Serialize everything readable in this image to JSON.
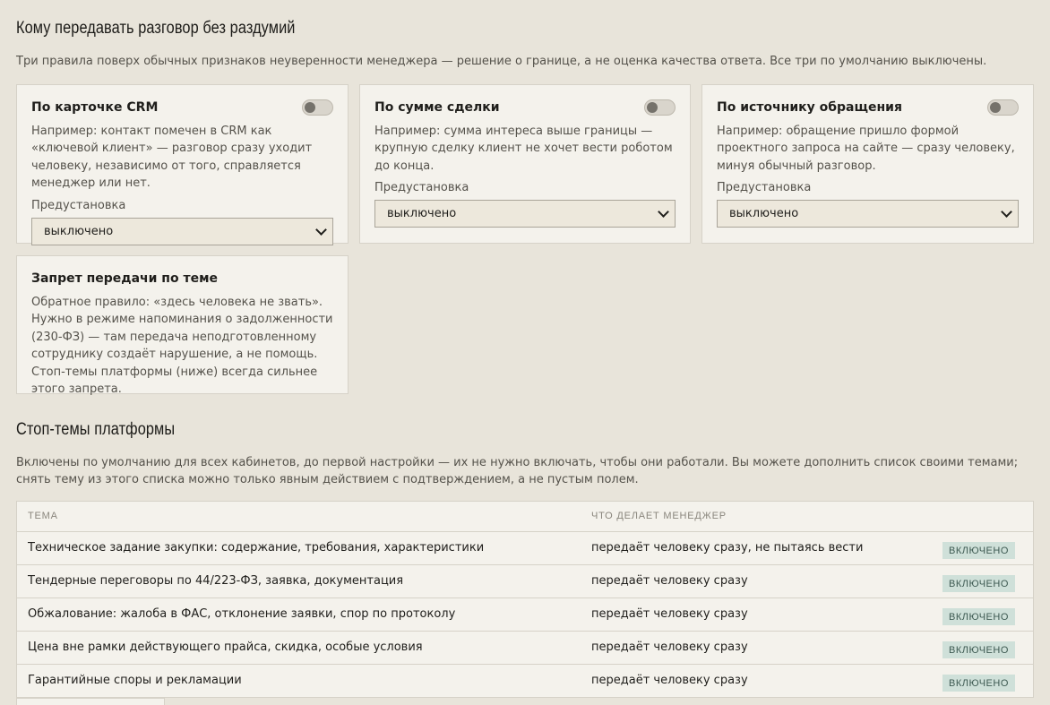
{
  "section1": {
    "title": "Кому передавать разговор без раздумий",
    "lede": "Три правила поверх обычных признаков неуверенности менеджера — решение о границе, а не оценка качества ответа. Все три по умолчанию выключены."
  },
  "cards": [
    {
      "title": "По карточке CRM",
      "toggle_on": false,
      "desc": "Например: контакт помечен в CRM как «ключевой клиент» — разговор сразу уходит человеку, независимо от того, справляется менеджер или нет.",
      "preset_label": "Предустановка",
      "preset_value": "выключено"
    },
    {
      "title": "По сумме сделки",
      "toggle_on": false,
      "desc": "Например: сумма интереса выше границы — крупную сделку клиент не хочет вести роботом до конца.",
      "preset_label": "Предустановка",
      "preset_value": "выключено"
    },
    {
      "title": "По источнику обращения",
      "toggle_on": false,
      "desc": "Например: обращение пришло формой проектного запроса на сайте — сразу человеку, минуя обычный разговор.",
      "preset_label": "Предустановка",
      "preset_value": "выключено"
    },
    {
      "title": "Запрет передачи по теме",
      "desc": "Обратное правило: «здесь человека не звать». Нужно в режиме напоминания о задолженности (230-ФЗ) — там передача неподготовленному сотруднику создаёт нарушение, а не помощь. Стоп-темы платформы (ниже) всегда сильнее этого запрета."
    }
  ],
  "section2": {
    "title": "Стоп-темы платформы",
    "lede": "Включены по умолчанию для всех кабинетов, до первой настройки — их не нужно включать, чтобы они работали. Вы можете дополнить список своими темами; снять тему из этого списка можно только явным действием с подтверждением, а не пустым полем."
  },
  "table": {
    "headers": [
      "Тема",
      "Что делает менеджер",
      ""
    ],
    "rows": [
      {
        "topic": "Техническое задание закупки: содержание, требования, характеристики",
        "action": "передаёт человеку сразу, не пытаясь вести",
        "status": "включено"
      },
      {
        "topic": "Тендерные переговоры по 44/223-ФЗ, заявка, документация",
        "action": "передаёт человеку сразу",
        "status": "включено"
      },
      {
        "topic": "Обжалование: жалоба в ФАС, отклонение заявки, спор по протоколу",
        "action": "передаёт человеку сразу",
        "status": "включено"
      },
      {
        "topic": "Цена вне рамки действующего прайса, скидка, особые условия",
        "action": "передаёт человеку сразу",
        "status": "включено"
      },
      {
        "topic": "Гарантийные споры и рекламации",
        "action": "передаёт человеку сразу",
        "status": "включено"
      }
    ]
  },
  "colors": {
    "background": "#e8e4da",
    "card": "#f4f2ec",
    "badge_bg": "#cfe0d9",
    "badge_text": "#3e5a52"
  },
  "icons": {
    "toggle": "toggle-switch-off",
    "select": "chevron-down-icon"
  }
}
